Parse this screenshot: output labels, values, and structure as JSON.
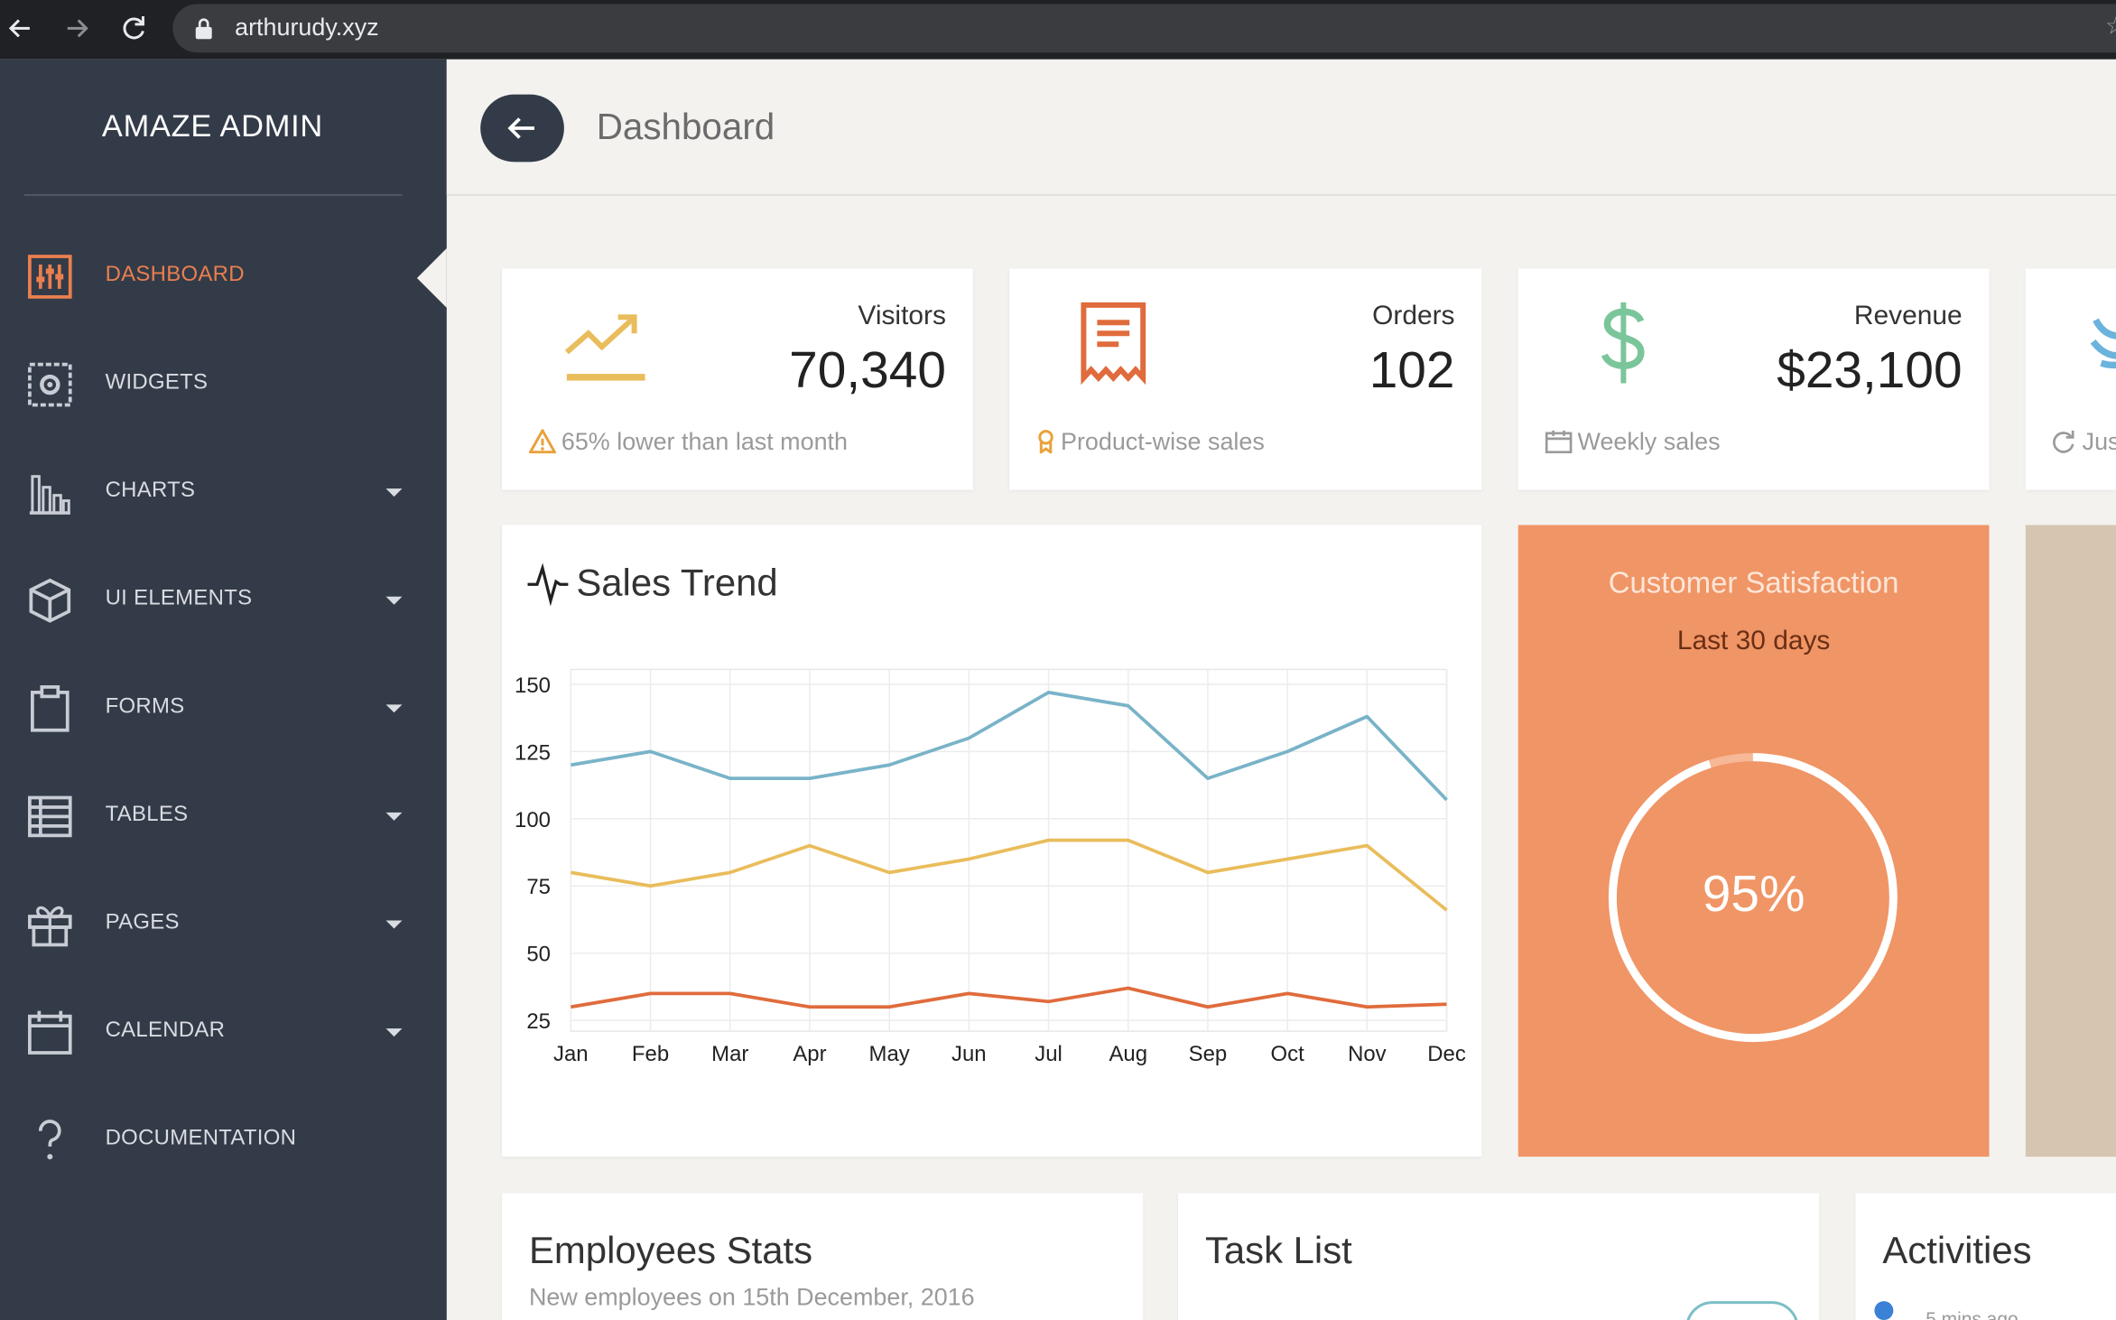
{
  "browser": {
    "url": "arthurudy.xyz"
  },
  "sidebar": {
    "brand": "AMAZE ADMIN",
    "items": [
      {
        "label": "DASHBOARD",
        "icon": "dashboard-sliders-icon",
        "active": true,
        "has_caret": false
      },
      {
        "label": "WIDGETS",
        "icon": "widget-gear-icon",
        "active": false,
        "has_caret": false
      },
      {
        "label": "CHARTS",
        "icon": "bar-chart-icon",
        "active": false,
        "has_caret": true
      },
      {
        "label": "UI ELEMENTS",
        "icon": "cube-icon",
        "active": false,
        "has_caret": true
      },
      {
        "label": "FORMS",
        "icon": "clipboard-icon",
        "active": false,
        "has_caret": true
      },
      {
        "label": "TABLES",
        "icon": "table-icon",
        "active": false,
        "has_caret": true
      },
      {
        "label": "PAGES",
        "icon": "gift-icon",
        "active": false,
        "has_caret": true
      },
      {
        "label": "CALENDAR",
        "icon": "calendar-icon",
        "active": false,
        "has_caret": true
      },
      {
        "label": "DOCUMENTATION",
        "icon": "question-mark-icon",
        "active": false,
        "has_caret": false
      }
    ]
  },
  "header": {
    "title": "Dashboard"
  },
  "stats": {
    "visitors": {
      "label": "Visitors",
      "value": "70,340",
      "foot": "65% lower than last month",
      "icon": "trending-up-icon",
      "foot_icon": "warning-icon"
    },
    "orders": {
      "label": "Orders",
      "value": "102",
      "foot": "Product-wise sales",
      "icon": "receipt-icon",
      "foot_icon": "bookmark-icon"
    },
    "revenue": {
      "label": "Revenue",
      "value": "$23,100",
      "foot": "Weekly sales",
      "icon": "dollar-icon",
      "foot_icon": "calendar-small-icon"
    },
    "partial": {
      "foot": "Jus",
      "icon": "twitter-bird-icon",
      "foot_icon": "refresh-icon"
    }
  },
  "satisfaction": {
    "title": "Customer Satisfaction",
    "subtitle": "Last 30 days",
    "value_label": "95%",
    "fraction": 0.95
  },
  "bottom": {
    "employees": {
      "title": "Employees Stats",
      "subtitle": "New employees on 15th December, 2016"
    },
    "tasks": {
      "title": "Task List"
    },
    "activities": {
      "title": "Activities",
      "first_item": "5 mins ago"
    }
  },
  "colors": {
    "sidebar_bg": "#333b48",
    "accent": "#ea7f4f",
    "page_bg": "#f3f2ef",
    "satisfaction_bg": "#f09566",
    "series_blue": "#79b3c8",
    "series_yellow": "#e9bd5c",
    "series_orange": "#e06b3c",
    "revenue_icon": "#7bc59a"
  },
  "chart_data": {
    "type": "line",
    "title": "Sales Trend",
    "categories": [
      "Jan",
      "Feb",
      "Mar",
      "Apr",
      "May",
      "Jun",
      "Jul",
      "Aug",
      "Sep",
      "Oct",
      "Nov",
      "Dec"
    ],
    "series": [
      {
        "values": [
          120,
          125,
          115,
          115,
          120,
          130,
          147,
          142,
          115,
          125,
          138,
          107
        ]
      },
      {
        "values": [
          80,
          75,
          80,
          90,
          80,
          85,
          92,
          92,
          80,
          85,
          90,
          66
        ]
      },
      {
        "values": [
          30,
          35,
          35,
          30,
          30,
          35,
          32,
          37,
          30,
          35,
          30,
          31
        ]
      }
    ],
    "yticks": [
      150,
      125,
      100,
      75,
      50,
      25
    ],
    "ylim": [
      25,
      155
    ],
    "grid": true,
    "legend": "none"
  }
}
